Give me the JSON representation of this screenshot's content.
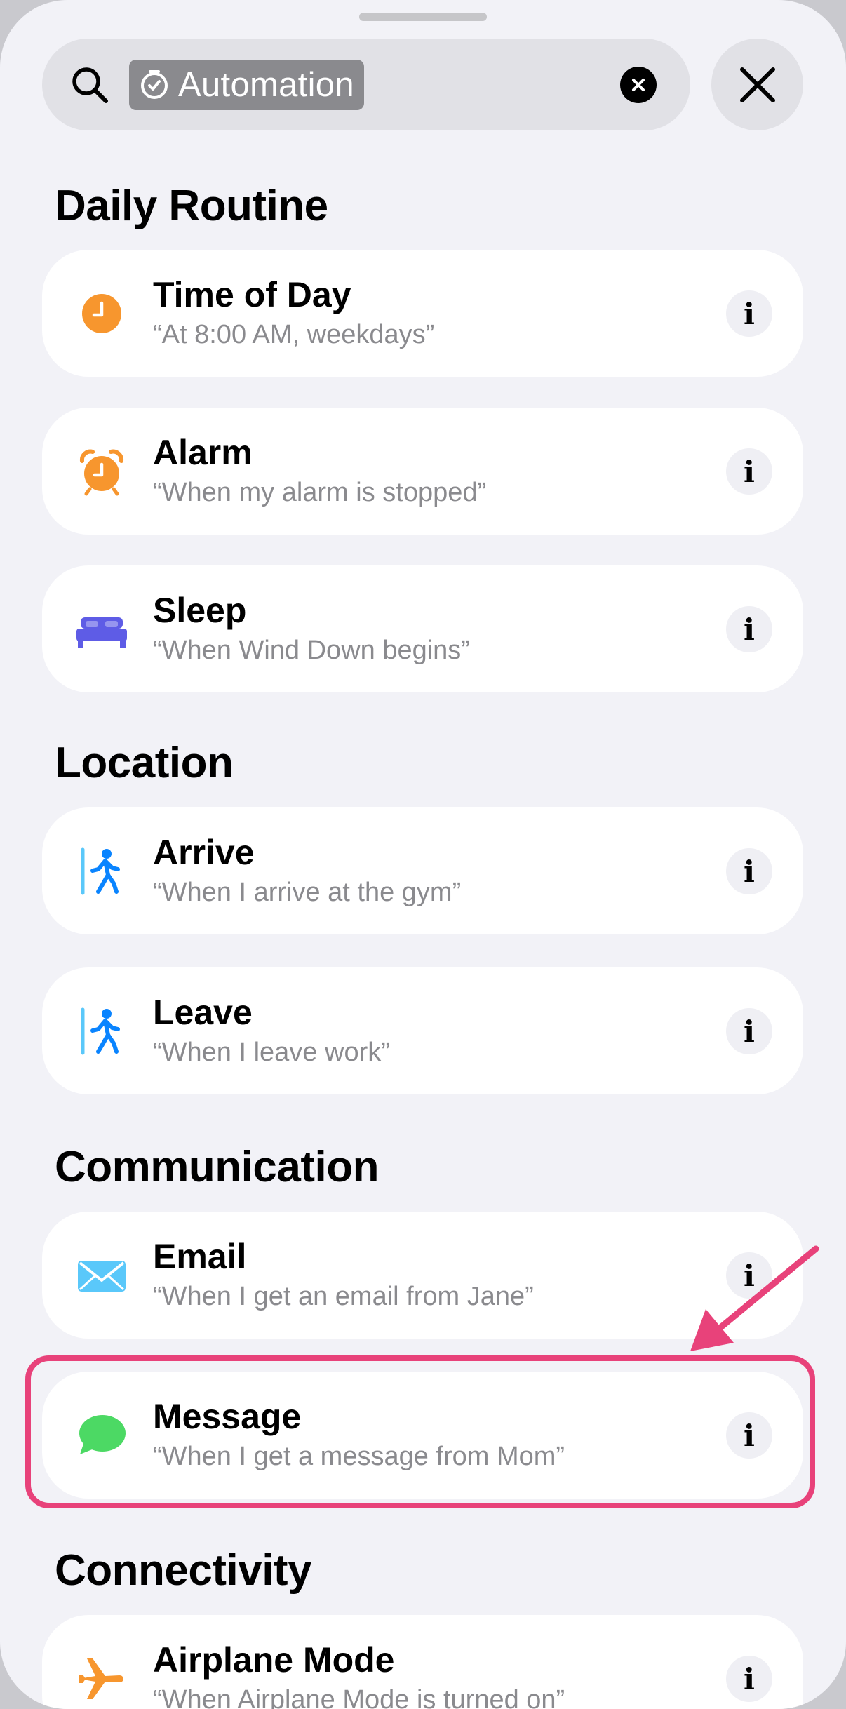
{
  "search": {
    "token_label": "Automation"
  },
  "sections": [
    {
      "title": "Daily Routine",
      "items": [
        {
          "title": "Time of Day",
          "subtitle": "“At 8:00 AM, weekdays”",
          "icon": "clock-icon",
          "icon_color": "#f7962e"
        },
        {
          "title": "Alarm",
          "subtitle": "“When my alarm is stopped”",
          "icon": "alarm-clock-icon",
          "icon_color": "#f7962e"
        },
        {
          "title": "Sleep",
          "subtitle": "“When Wind Down begins”",
          "icon": "bed-icon",
          "icon_color": "#5e5ce6"
        }
      ]
    },
    {
      "title": "Location",
      "items": [
        {
          "title": "Arrive",
          "subtitle": "“When I arrive at the gym”",
          "icon": "walk-arrive-icon",
          "icon_color": "#0a84ff"
        },
        {
          "title": "Leave",
          "subtitle": "“When I leave work”",
          "icon": "walk-leave-icon",
          "icon_color": "#0a84ff"
        }
      ]
    },
    {
      "title": "Communication",
      "items": [
        {
          "title": "Email",
          "subtitle": "“When I get an email from Jane”",
          "icon": "envelope-icon",
          "icon_color": "#5ac8fa"
        },
        {
          "title": "Message",
          "subtitle": "“When I get a message from Mom”",
          "icon": "message-bubble-icon",
          "icon_color": "#4cd964"
        }
      ]
    },
    {
      "title": "Connectivity",
      "items": [
        {
          "title": "Airplane Mode",
          "subtitle": "“When Airplane Mode is turned on”",
          "icon": "airplane-icon",
          "icon_color": "#f7962e"
        }
      ]
    }
  ],
  "info_label": "i",
  "highlight_color": "#e8427a"
}
